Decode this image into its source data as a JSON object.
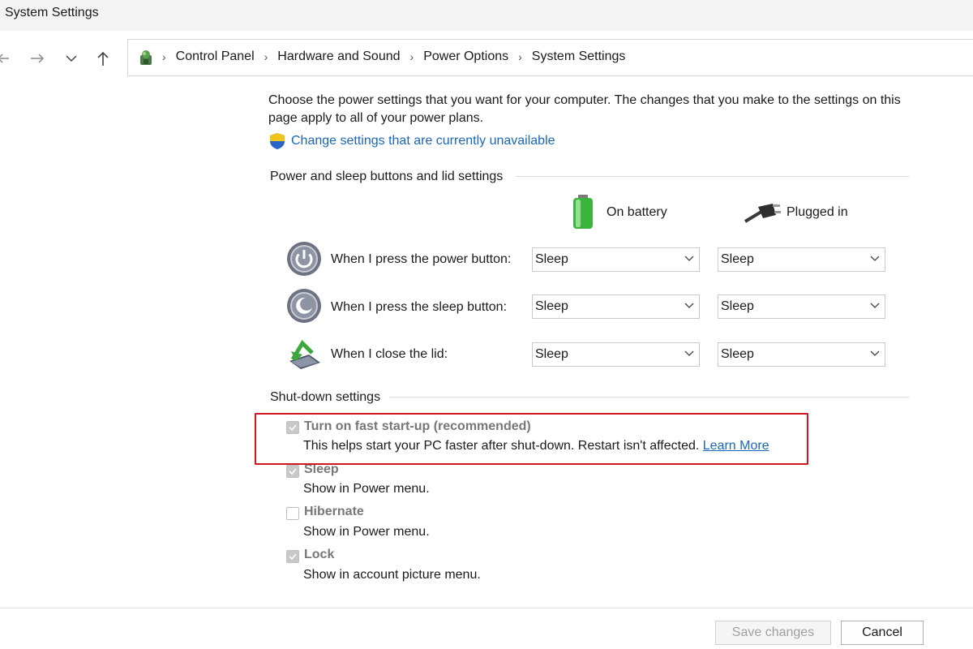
{
  "window": {
    "title": "System Settings"
  },
  "breadcrumb": [
    "Control Panel",
    "Hardware and Sound",
    "Power Options",
    "System Settings"
  ],
  "intro_text": "Choose the power settings that you want for your computer. The changes that you make to the settings on this page apply to all of your power plans.",
  "change_link": "Change settings that are currently unavailable",
  "power_section": {
    "title": "Power and sleep buttons and lid settings",
    "col_battery": "On battery",
    "col_plugged": "Plugged in",
    "rows": [
      {
        "label": "When I press the power button:",
        "battery": "Sleep",
        "plugged": "Sleep",
        "icon": "power-button-icon"
      },
      {
        "label": "When I press the sleep button:",
        "battery": "Sleep",
        "plugged": "Sleep",
        "icon": "sleep-button-icon"
      },
      {
        "label": "When I close the lid:",
        "battery": "Sleep",
        "plugged": "Sleep",
        "icon": "laptop-lid-icon"
      }
    ]
  },
  "shutdown_section": {
    "title": "Shut-down settings",
    "options": [
      {
        "label": "Turn on fast start-up (recommended)",
        "desc": "This helps start your PC faster after shut-down. Restart isn't affected.",
        "link": "Learn More",
        "checked": true
      },
      {
        "label": "Sleep",
        "desc": "Show in Power menu.",
        "checked": true
      },
      {
        "label": "Hibernate",
        "desc": "Show in Power menu.",
        "checked": false
      },
      {
        "label": "Lock",
        "desc": "Show in account picture menu.",
        "checked": true
      }
    ]
  },
  "buttons": {
    "save": "Save changes",
    "cancel": "Cancel"
  },
  "colors": {
    "link": "#1a66b8",
    "highlight": "#d3151d",
    "battery": "#3cb33c"
  }
}
